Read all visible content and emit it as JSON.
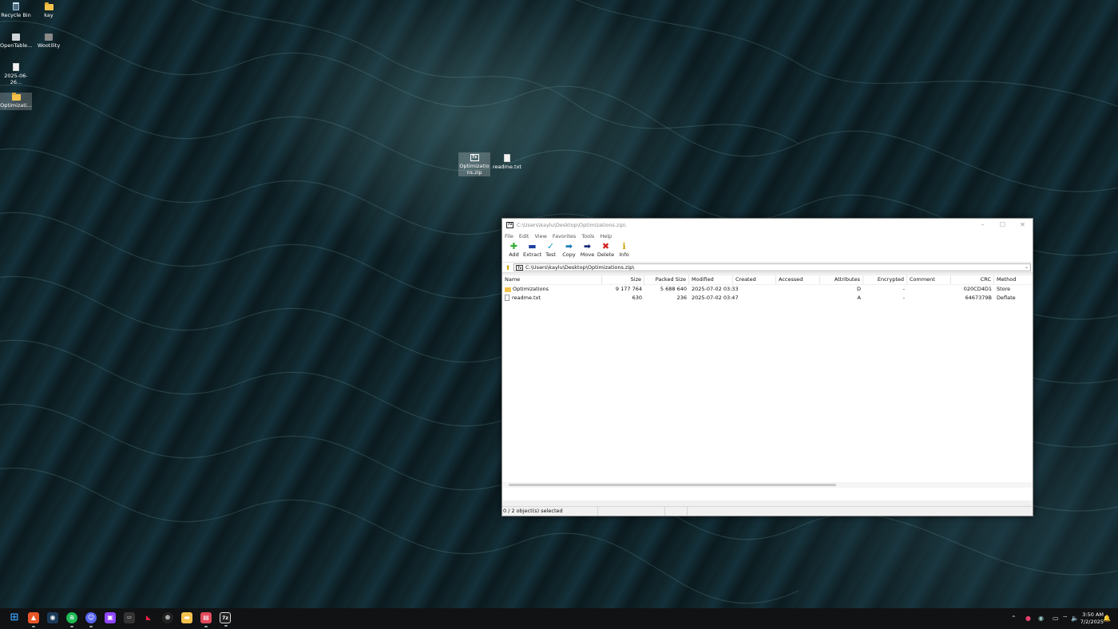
{
  "desktop": {
    "icons": [
      {
        "label": "Recycle Bin",
        "icon": "recycle-bin-icon"
      },
      {
        "label": "kay",
        "icon": "folder-icon"
      },
      {
        "label": "OpenTable...",
        "icon": "app-icon"
      },
      {
        "label": "Wootility",
        "icon": "app-icon"
      },
      {
        "label": "2025-06-26...",
        "icon": "document-icon"
      },
      {
        "label": "Optimizati...",
        "icon": "folder-icon"
      },
      {
        "label": "Optimizations.zip",
        "icon": "7zip-archive-icon"
      },
      {
        "label": "readme.txt",
        "icon": "text-file-icon"
      }
    ]
  },
  "window": {
    "title": "C:\\Users\\kaylu\\Desktop\\Optimizations.zip\\",
    "controls": {
      "minimize": "–",
      "maximize": "☐",
      "close": "✕"
    },
    "menu": [
      "File",
      "Edit",
      "View",
      "Favorites",
      "Tools",
      "Help"
    ],
    "toolbar": [
      {
        "label": "Add",
        "icon": "add-icon",
        "color": "#2fae2f"
      },
      {
        "label": "Extract",
        "icon": "extract-icon",
        "color": "#1f3f9e"
      },
      {
        "label": "Test",
        "icon": "test-icon",
        "color": "#1aa1c9"
      },
      {
        "label": "Copy",
        "icon": "copy-icon",
        "color": "#1d7fb8"
      },
      {
        "label": "Move",
        "icon": "move-icon",
        "color": "#1a2d7a"
      },
      {
        "label": "Delete",
        "icon": "delete-icon",
        "color": "#d42020"
      },
      {
        "label": "Info",
        "icon": "info-icon",
        "color": "#c9a100"
      }
    ],
    "address": "C:\\Users\\kaylu\\Desktop\\Optimizations.zip\\",
    "columns": [
      "Name",
      "Size",
      "Packed Size",
      "Modified",
      "Created",
      "Accessed",
      "Attributes",
      "Encrypted",
      "Comment",
      "CRC",
      "Method"
    ],
    "rows": [
      {
        "name": "Optimizations",
        "type": "folder",
        "size": "9 177 764",
        "packed": "5 688 640",
        "modified": "2025-07-02 03:33",
        "created": "",
        "accessed": "",
        "attributes": "D",
        "encrypted": "-",
        "comment": "",
        "crc": "020CD4D1",
        "method": "Store"
      },
      {
        "name": "readme.txt",
        "type": "file",
        "size": "630",
        "packed": "236",
        "modified": "2025-07-02 03:47",
        "created": "",
        "accessed": "",
        "attributes": "A",
        "encrypted": "-",
        "comment": "",
        "crc": "6467379B",
        "method": "Deflate"
      }
    ],
    "status": "0 / 2 object(s) selected"
  },
  "taskbar": {
    "apps": [
      "windows-start-icon",
      "brave-icon",
      "steam-icon",
      "spotify-icon",
      "discord-icon",
      "twitch-icon",
      "terminal-icon",
      "app-icon",
      "epic-games-icon",
      "file-explorer-icon",
      "app-icon",
      "7zip-icon"
    ],
    "time": "3:50 AM",
    "date": "7/2/2025"
  }
}
